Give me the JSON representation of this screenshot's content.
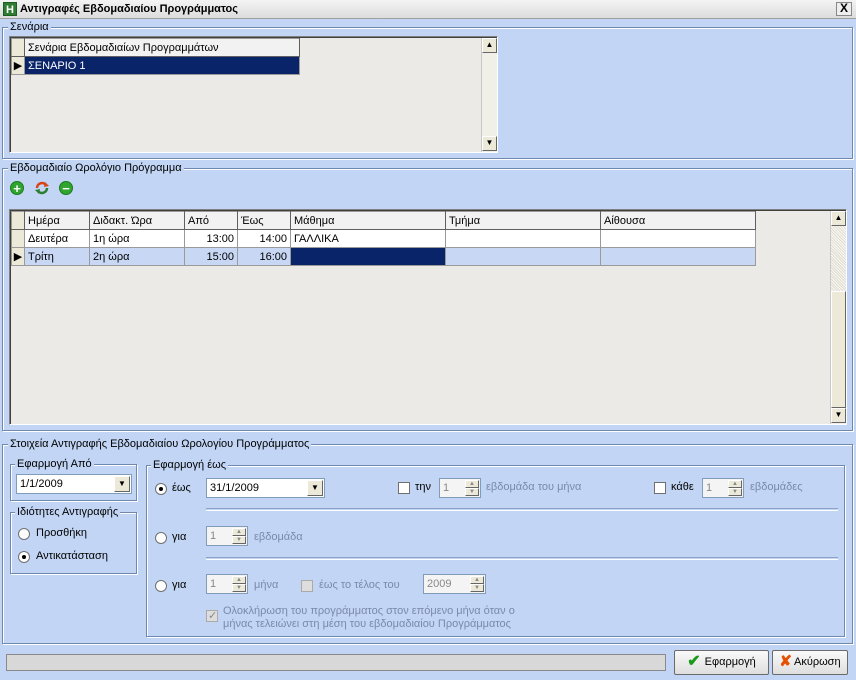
{
  "window": {
    "title": "Αντιγραφές Εβδομαδιαίου Προγράμματος",
    "app_icon_letter": "H",
    "close_symbol": "X"
  },
  "scenarios": {
    "group_label": "Σενάρια",
    "column_header": "Σενάρια Εβδομαδιαίων Προγραμμάτων",
    "rows": [
      "ΣΕΝΑΡΙΟ 1"
    ],
    "row_indicator": "▶"
  },
  "schedule": {
    "group_label": "Εβδομαδιαίο Ωρολόγιο Πρόγραμμα",
    "toolbar": {
      "add_icon": "add-icon",
      "refresh_icon": "refresh-icon",
      "remove_icon": "remove-icon"
    },
    "columns": [
      "Ημέρα",
      "Διδακτ. Ώρα",
      "Από",
      "Έως",
      "Μάθημα",
      "Τμήμα",
      "Αίθουσα"
    ],
    "rows": [
      [
        "Δευτέρα",
        "1η ώρα",
        "13:00",
        "14:00",
        "ΓΑΛΛΙΚΑ",
        "",
        ""
      ],
      [
        "Τρίτη",
        "2η ώρα",
        "15:00",
        "16:00",
        "",
        "",
        ""
      ]
    ],
    "row_indicator": "▶"
  },
  "copy": {
    "group_label": "Στοιχεία Αντιγραφής Εβδομαδιαίου Ωρολογίου Προγράμματος",
    "apply_from": {
      "label": "Εφαρμογή Από",
      "value": "1/1/2009"
    },
    "copy_mode": {
      "label": "Ιδιότητες Αντιγραφής",
      "options": [
        "Προσθήκη",
        "Αντικατάσταση"
      ],
      "selected": "Αντικατάσταση"
    },
    "apply_until": {
      "label": "Εφαρμογή έως",
      "until_option": {
        "label": "έως",
        "date": "31/1/2009",
        "selected": true
      },
      "week_of_month": {
        "checkbox_label": "την",
        "value": "1",
        "suffix": "εβδομάδα του μήνα",
        "checked": false
      },
      "every_weeks": {
        "checkbox_label": "κάθε",
        "value": "1",
        "suffix": "εβδομάδες",
        "checked": false
      },
      "for_weeks": {
        "label": "για",
        "value": "1",
        "suffix": "εβδομάδα",
        "selected": false
      },
      "for_months": {
        "label": "για",
        "value": "1",
        "suffix": "μήνα",
        "selected": false
      },
      "end_of_year": {
        "checkbox_label": "έως το τέλος του",
        "year": "2009",
        "checked": false
      },
      "complete_month": {
        "line1": "Ολοκλήρωση του προγράμματος στον επόμενο μήνα όταν ο",
        "line2": "μήνας τελειώνει στη μέση του εβδομαδιαίου Προγράμματος",
        "checked": true
      }
    }
  },
  "footer": {
    "progress": 0,
    "apply_label": "Εφαρμογή",
    "cancel_label": "Ακύρωση"
  },
  "colors": {
    "background": "#c2d5f4",
    "selection": "#0a246a",
    "selected_row": "#c8d7f4",
    "add_green": "#2fa52f",
    "remove_green": "#2fa52f"
  }
}
